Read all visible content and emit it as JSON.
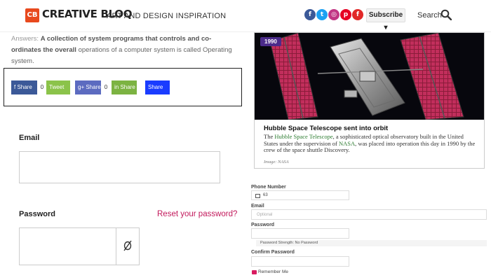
{
  "header": {
    "logo_mark": "CB",
    "logo_text": "CREATIVE BLOQ",
    "tagline": "ART AND DESIGN INSPIRATION",
    "social": [
      {
        "name": "facebook-icon",
        "glyph": "f",
        "color": "#3b5998"
      },
      {
        "name": "twitter-icon",
        "glyph": "t",
        "color": "#1da1f2"
      },
      {
        "name": "instagram-icon",
        "glyph": "◎",
        "color": "#c13584"
      },
      {
        "name": "pinterest-icon",
        "glyph": "p",
        "color": "#e60023"
      },
      {
        "name": "flipboard-icon",
        "glyph": "f",
        "color": "#e12828"
      }
    ],
    "subscribe_label": "Subscribe ▾",
    "search_label": "Search"
  },
  "answer": {
    "label": "Answers:",
    "bold": "A collection of system programs that controls and co-ordinates the overall",
    "rest": "operations of a computer system is called Operating system."
  },
  "share": {
    "buttons": [
      {
        "label": "f Share",
        "count": "0",
        "color": "#3b5998"
      },
      {
        "label": "Tweet",
        "count": "",
        "color": "#8bc34a"
      },
      {
        "label": "g+ Share",
        "count": "0",
        "color": "#5c6bc0"
      },
      {
        "label": "in Share",
        "count": "",
        "color": "#7cb342"
      },
      {
        "label": "Share",
        "count": "",
        "color": "#1a3cff"
      }
    ]
  },
  "login": {
    "email_label": "Email",
    "password_label": "Password",
    "reset_link": "Reset your password?",
    "eye_glyph": "ø"
  },
  "card": {
    "badge": "1990",
    "title": "Hubble Space Telescope sent into orbit",
    "body_pre": "The ",
    "link1": "Hubble Space Telescope",
    "body_mid": ", a sophisticated optical observatory built in the United States under the supervision of ",
    "link2": "NASA",
    "body_post": ", was placed into operation this day in 1990 by the crew of the space shuttle Discovery.",
    "credit": "Image: NASA"
  },
  "signup": {
    "phone_label": "Phone Number",
    "phone_code": "63",
    "email_label": "Email",
    "email_placeholder": "Optional",
    "password_label": "Password",
    "strength_text": "Password Strength: No Password",
    "confirm_label": "Confirm Password",
    "remember_label": "Remember Me"
  },
  "colors": {
    "brand": "#e8491d",
    "reset_link": "#c2185b",
    "badge_purple": "#4b2b8a",
    "link_green": "#2e7d32",
    "checkbox": "#d81b60"
  }
}
